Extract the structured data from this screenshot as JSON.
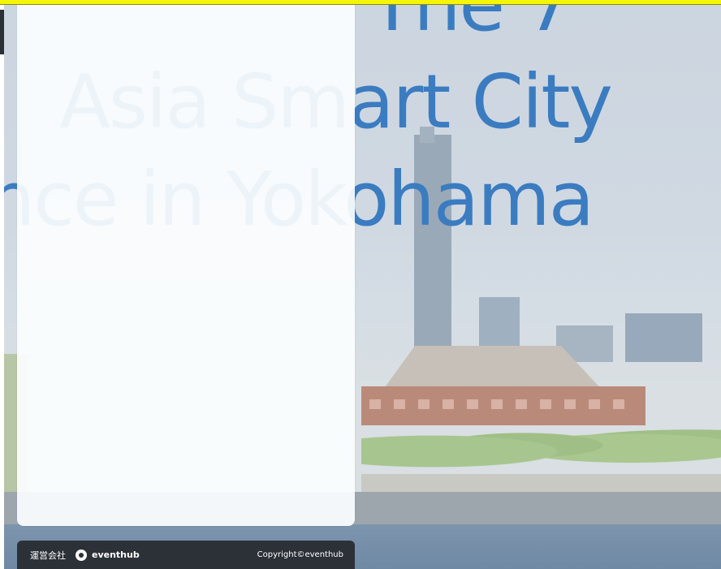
{
  "hero": {
    "line1": "The 7",
    "line2": "Asia Smart City",
    "line3": "nce in Yokohama"
  },
  "footer": {
    "operator_label": "運営会社",
    "brand_name": "eventhub",
    "copyright": "Copyright©eventhub"
  },
  "colors": {
    "title_blue": "#3b7cc1",
    "footer_bg": "#2c3138",
    "top_strip": "#f5f50a"
  },
  "icons": {
    "brand_logo": "eventhub-logo-icon"
  }
}
